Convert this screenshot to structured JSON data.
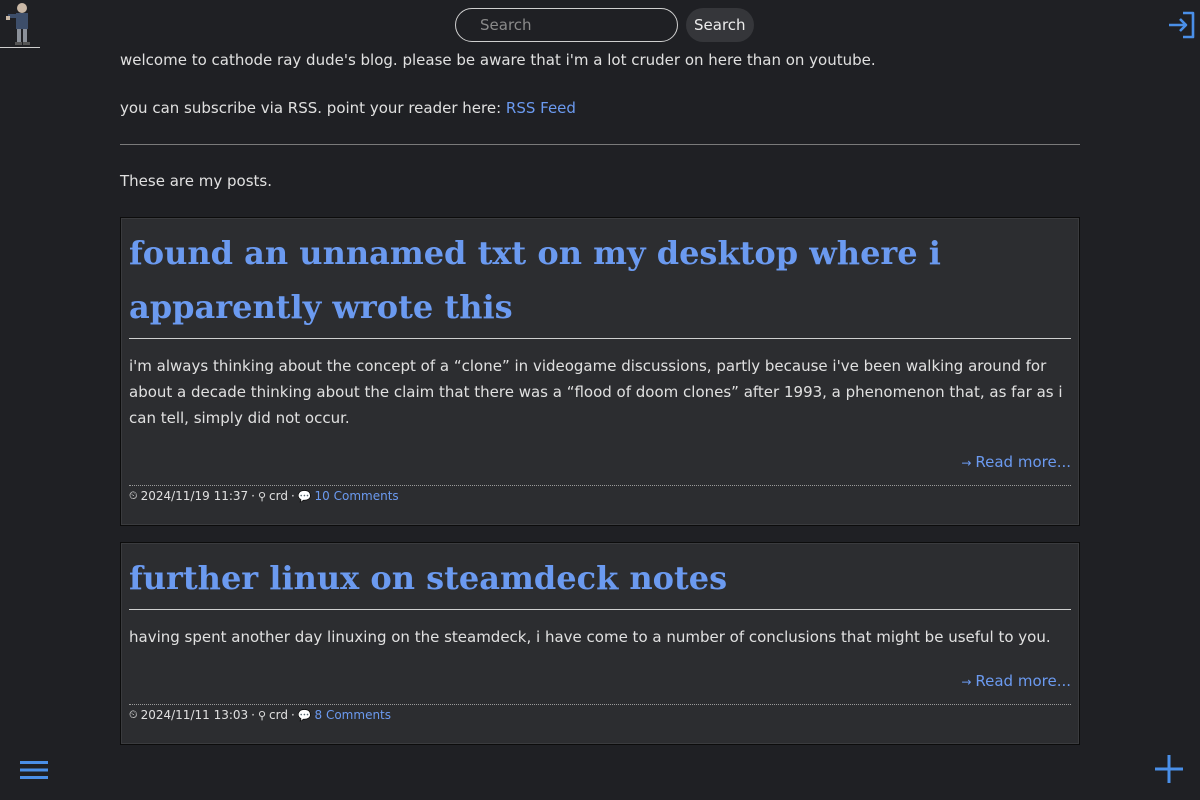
{
  "header": {
    "search_placeholder": "Search",
    "search_button": "Search"
  },
  "intro": {
    "welcome": "welcome to cathode ray dude's blog. please be aware that i'm a lot cruder on here than on youtube.",
    "subscribe_prefix": "you can subscribe via RSS. point your reader here: ",
    "rss_link": "RSS Feed",
    "posts_heading": "These are my posts."
  },
  "posts": [
    {
      "title": "found an unnamed txt on my desktop where i apparently wrote this",
      "excerpt": "i'm always thinking about the concept of a “clone” in videogame discussions, partly because i've been walking around for about a decade thinking about the claim that there was a “flood of doom clones” after 1993, a phenomenon that, as far as i can tell, simply did not occur.",
      "read_more": "Read more...",
      "date": "2024/11/19 11:37",
      "author": "crd",
      "comments": "10 Comments"
    },
    {
      "title": "further linux on steamdeck notes",
      "excerpt": "having spent another day linuxing on the steamdeck, i have come to a number of conclusions that might be useful to you.",
      "read_more": "Read more...",
      "date": "2024/11/11 13:03",
      "author": "crd",
      "comments": "8 Comments"
    }
  ],
  "colors": {
    "background": "#1f2024",
    "accent": "#6b9af0",
    "card": "#2c2d30"
  },
  "icons": {
    "login": "login-icon",
    "menu": "hamburger-menu-icon",
    "add": "plus-icon",
    "clock": "clock-icon",
    "author": "user-icon",
    "comments": "speech-bubble-icon"
  }
}
